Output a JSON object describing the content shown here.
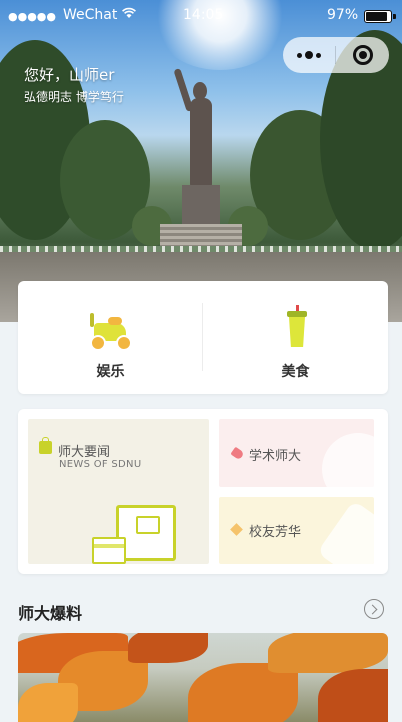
{
  "status_bar": {
    "signal": "●●●●●",
    "carrier": "WeChat",
    "wifi_icon": "wifi-icon",
    "time": "14:05",
    "battery_percent": "97%"
  },
  "capsule": {
    "more_icon": "more-dots-icon",
    "close_icon": "close-target-icon"
  },
  "hero": {
    "greeting": "您好，山师er",
    "motto": "弘德明志 博学笃行"
  },
  "categories": [
    {
      "label": "娱乐",
      "icon": "scooter-icon"
    },
    {
      "label": "美食",
      "icon": "cup-icon"
    }
  ],
  "features": {
    "news": {
      "title": "师大要闻",
      "subtitle": "NEWS OF SDNU",
      "icon": "bag-icon"
    },
    "academic": {
      "title": "学术师大",
      "icon": "tag-icon"
    },
    "alumni": {
      "title": "校友芳华",
      "icon": "diamond-icon"
    }
  },
  "section": {
    "title": "师大爆料",
    "more_icon": "chevron-right-circle-icon"
  },
  "colors": {
    "background": "#eef3f6",
    "accent_yellow_green": "#c8d22a",
    "news_tile": "#f3f1e6",
    "academic_tile": "#fbeeee",
    "alumni_tile": "#fbf5dc"
  }
}
